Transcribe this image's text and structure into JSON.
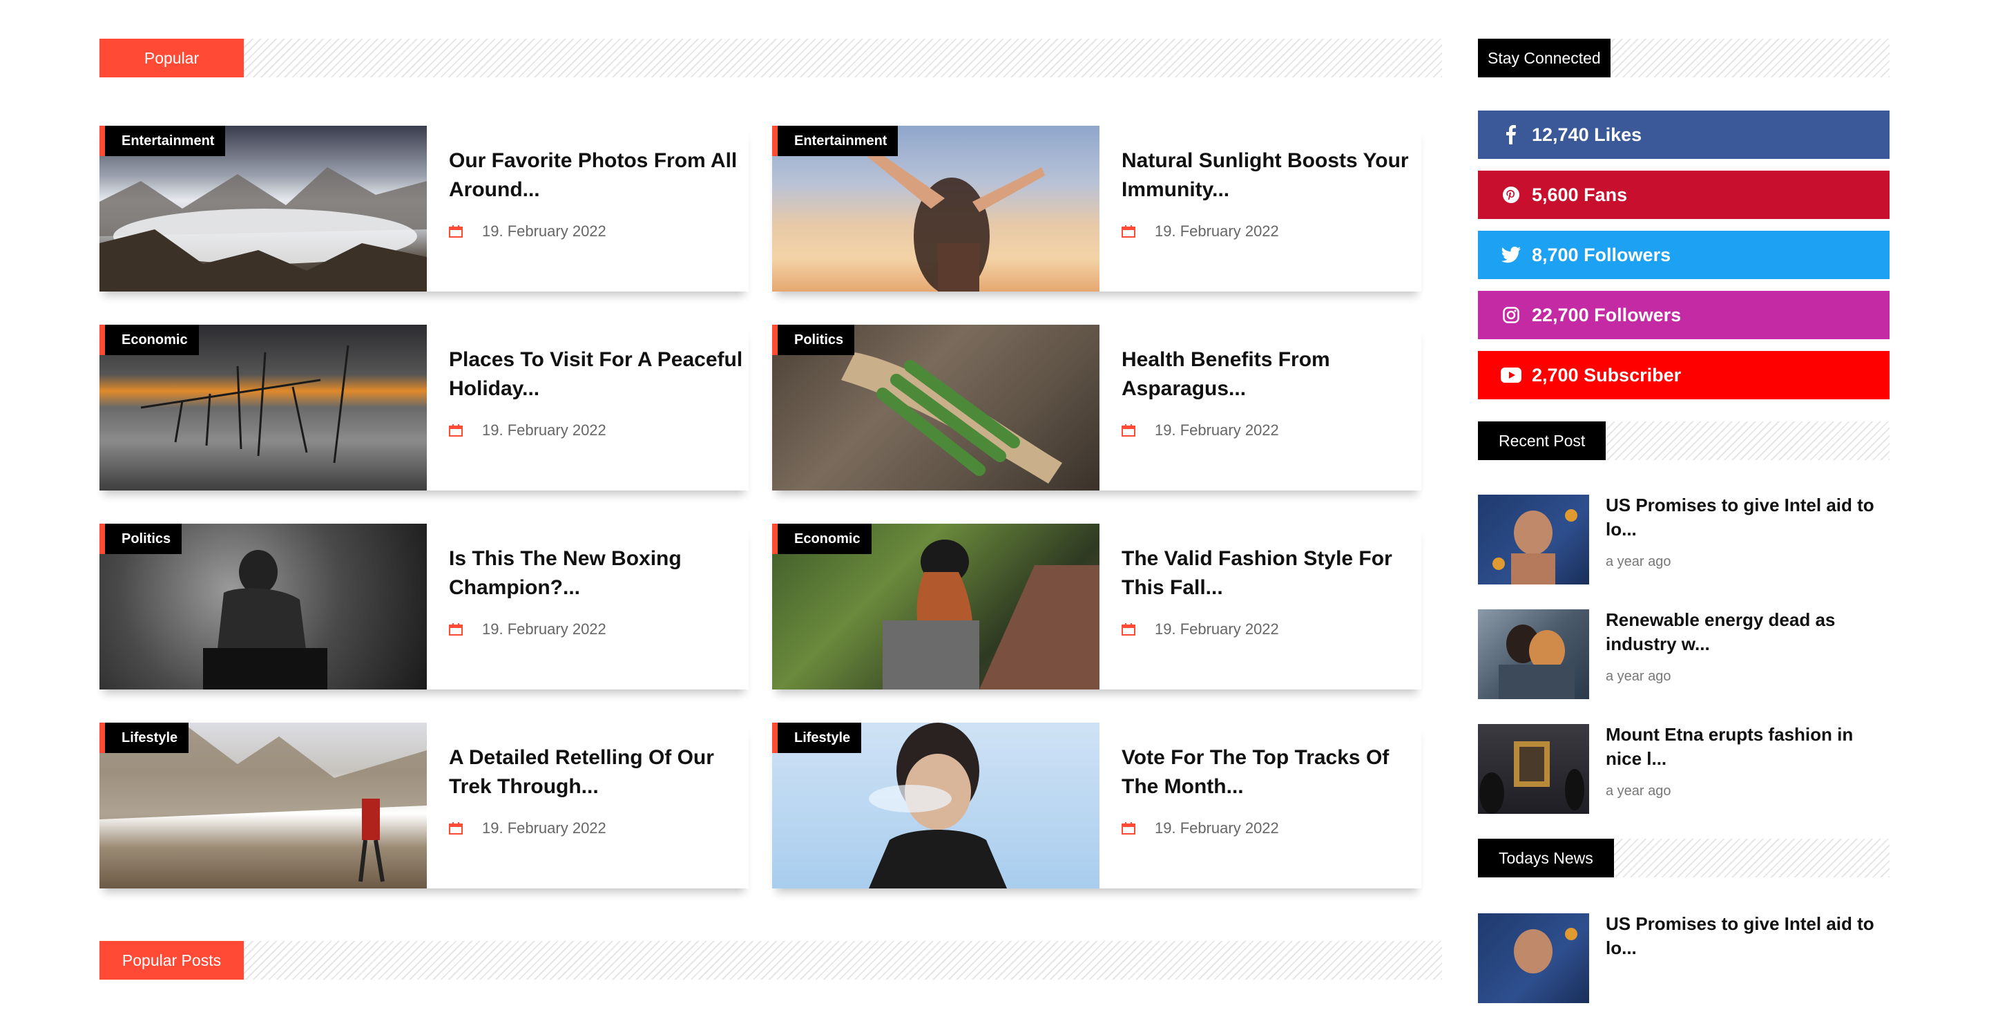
{
  "popular": {
    "heading": "Popular",
    "cards": [
      {
        "category": "Entertainment",
        "title": "Our Favorite Photos From All Around...",
        "date": "19. February 2022"
      },
      {
        "category": "Entertainment",
        "title": "Natural Sunlight Boosts Your Immunity...",
        "date": "19. February 2022"
      },
      {
        "category": "Economic",
        "title": "Places To Visit For A Peaceful Holiday...",
        "date": "19. February 2022"
      },
      {
        "category": "Politics",
        "title": "Health Benefits From Asparagus...",
        "date": "19. February 2022"
      },
      {
        "category": "Politics",
        "title": "Is This The New Boxing Champion?...",
        "date": "19. February 2022"
      },
      {
        "category": "Economic",
        "title": "The Valid Fashion Style For This Fall...",
        "date": "19. February 2022"
      },
      {
        "category": "Lifestyle",
        "title": "A Detailed Retelling Of Our Trek Through...",
        "date": "19. February 2022"
      },
      {
        "category": "Lifestyle",
        "title": "Vote For The Top Tracks Of The Month...",
        "date": "19. February 2022"
      }
    ]
  },
  "popular_posts": {
    "heading": "Popular Posts"
  },
  "stay_connected": {
    "heading": "Stay Connected",
    "items": [
      {
        "icon": "facebook-icon",
        "text": "12,740 Likes",
        "color": "#3b5998"
      },
      {
        "icon": "pinterest-icon",
        "text": "5,600 Fans",
        "color": "#c8102e"
      },
      {
        "icon": "twitter-icon",
        "text": "8,700 Followers",
        "color": "#1da1f2"
      },
      {
        "icon": "instagram-icon",
        "text": "22,700 Followers",
        "color": "#c32aa3"
      },
      {
        "icon": "youtube-icon",
        "text": "2,700 Subscriber",
        "color": "#ff0000"
      }
    ]
  },
  "recent_post": {
    "heading": "Recent Post",
    "items": [
      {
        "title": "US Promises to give Intel aid to lo...",
        "time": "a year ago"
      },
      {
        "title": "Renewable energy dead as industry w...",
        "time": "a year ago"
      },
      {
        "title": "Mount Etna erupts fashion in nice l...",
        "time": "a year ago"
      }
    ]
  },
  "todays_news": {
    "heading": "Todays News",
    "items": [
      {
        "title": "US Promises to give Intel aid to lo..."
      }
    ]
  },
  "colors": {
    "accent": "#ff4a35",
    "dark": "#000000"
  }
}
